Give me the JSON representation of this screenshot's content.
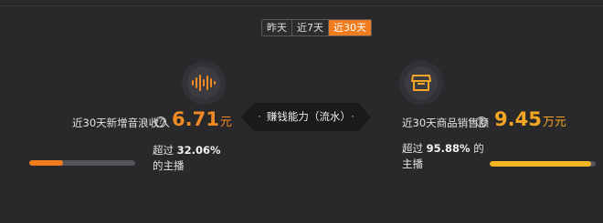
{
  "tabs": [
    "昨天",
    "近7天",
    "近30天"
  ],
  "active_tab": "近30天",
  "center_banner": {
    "label": "赚钱能力（流水）",
    "dot_left": "·",
    "dot_right": "·"
  },
  "left_metric": {
    "icon": "sound-wave-icon",
    "label": "近30天新增音浪收入",
    "help": "?",
    "value": "6.71",
    "unit": "元",
    "rank_prefix": "超过",
    "rank_percent": "32.06%",
    "rank_suffix": "的主播",
    "progress_fraction": 0.3206,
    "bar_color": "#f07c1e"
  },
  "right_metric": {
    "icon": "shop-icon",
    "label": "近30天商品销售额",
    "help": "?",
    "value": "9.45",
    "unit": "万元",
    "rank_prefix": "超过",
    "rank_percent": "95.88%",
    "rank_suffix_1": "的",
    "rank_suffix_2": "主播",
    "progress_fraction": 0.9588,
    "bar_color": "#f5b623"
  },
  "colors": {
    "background": "#29292b",
    "accent_orange": "#f07c1e",
    "accent_gold": "#f5a623"
  }
}
